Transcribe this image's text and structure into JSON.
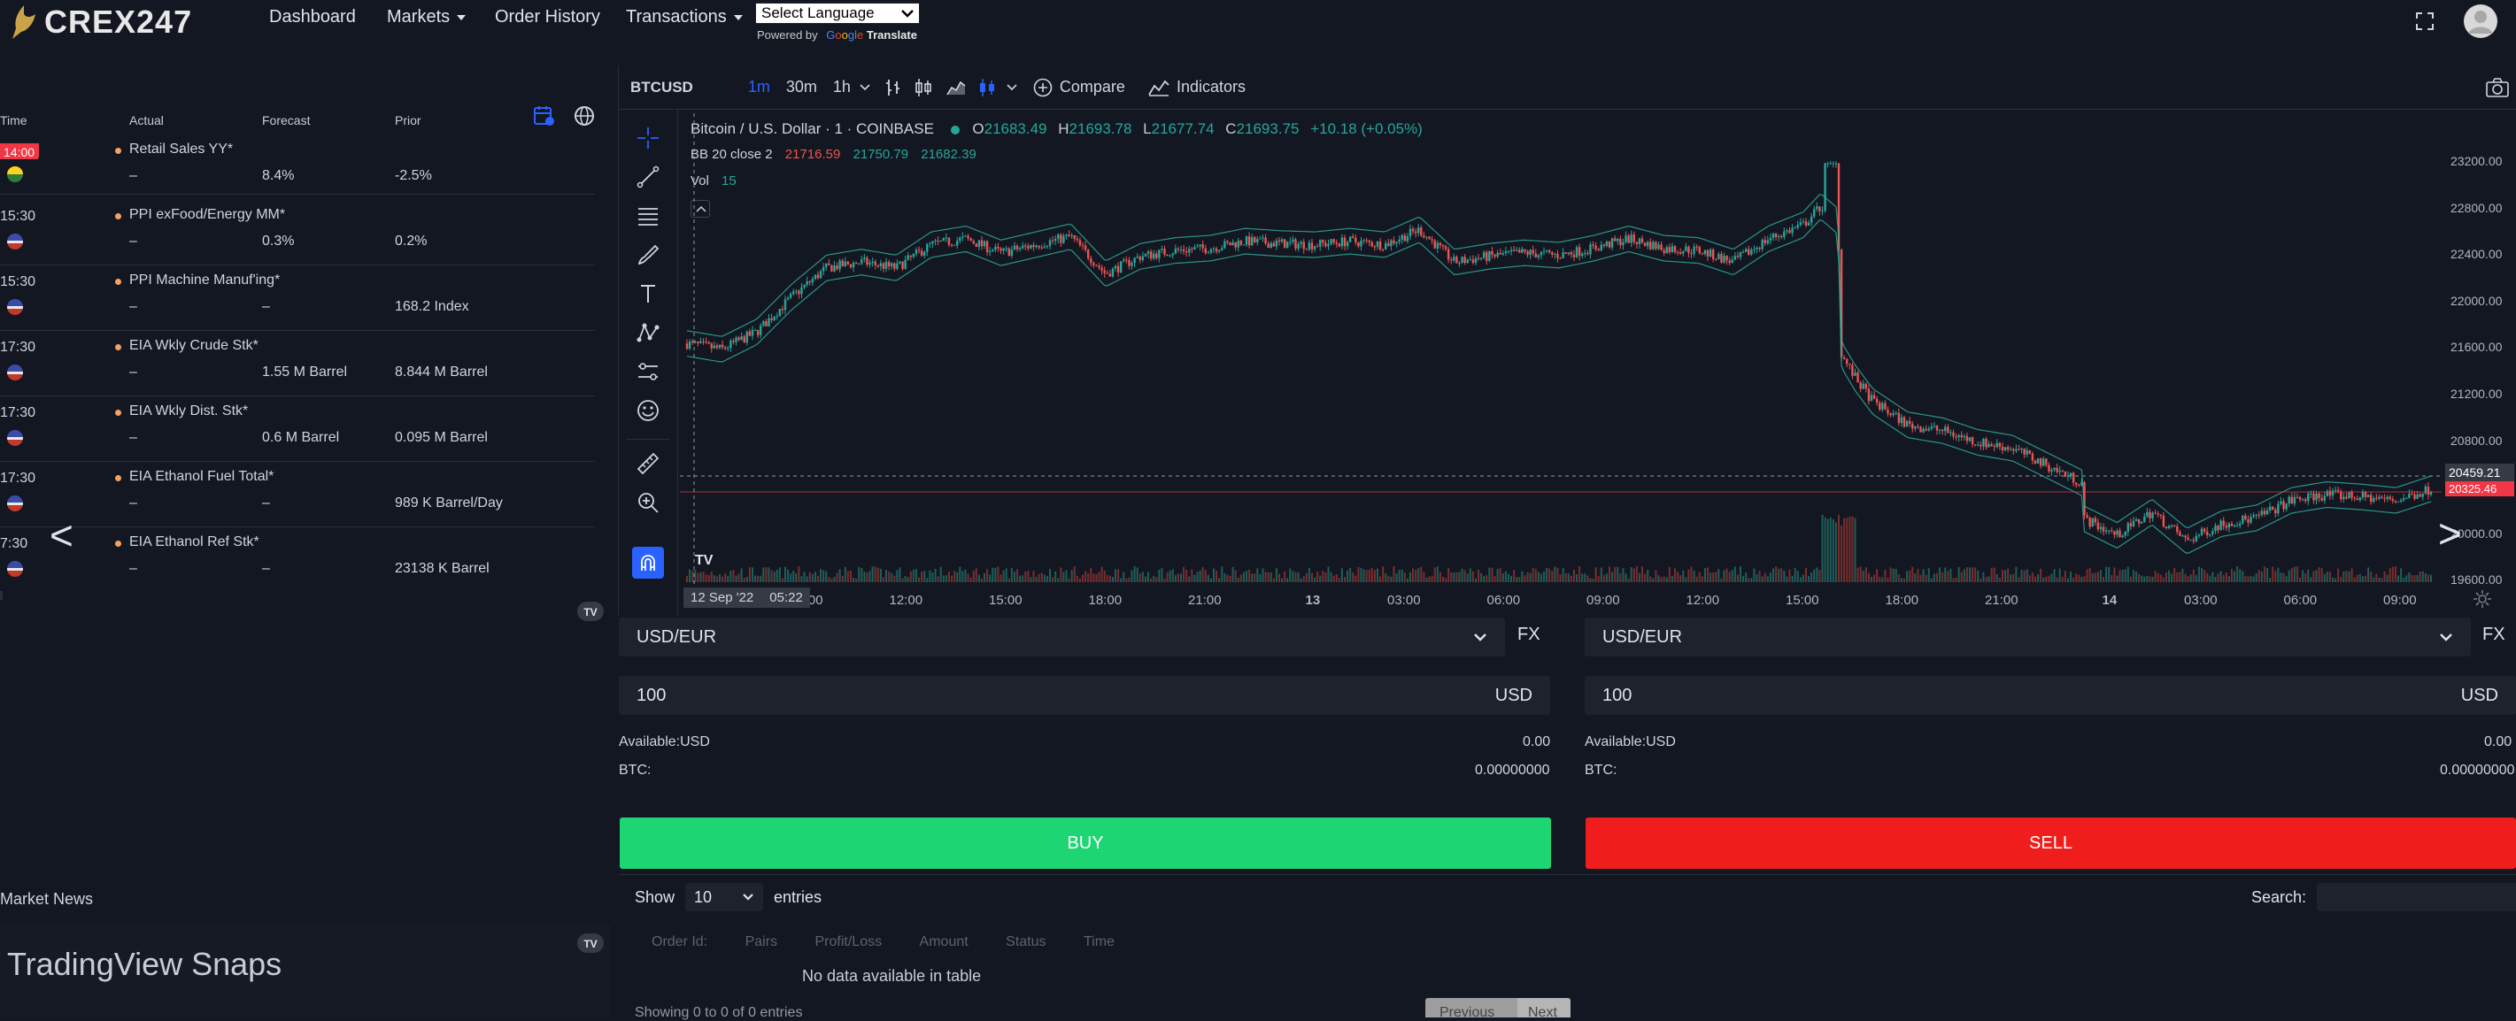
{
  "brand": "CREX247",
  "nav": {
    "dashboard": "Dashboard",
    "markets": "Markets",
    "order_history": "Order History",
    "transactions": "Transactions",
    "language_select": "Select Language",
    "powered_by": "Powered by",
    "translate": "Translate"
  },
  "calendar": {
    "headers": {
      "time": "Time",
      "actual": "Actual",
      "forecast": "Forecast",
      "prior": "Prior"
    },
    "events": [
      {
        "time": "14:00",
        "name": "Retail Sales YY*",
        "actual": "–",
        "forecast": "8.4%",
        "prior": "-2.5%"
      },
      {
        "time": "15:30",
        "name": "PPI exFood/Energy MM*",
        "actual": "–",
        "forecast": "0.3%",
        "prior": "0.2%"
      },
      {
        "time": "15:30",
        "name": "PPI Machine Manuf'ing*",
        "actual": "–",
        "forecast": "–",
        "prior": "168.2 Index"
      },
      {
        "time": "17:30",
        "name": "EIA Wkly Crude Stk*",
        "actual": "–",
        "forecast": "1.55 M Barrel",
        "prior": "8.844 M Barrel"
      },
      {
        "time": "17:30",
        "name": "EIA Wkly Dist. Stk*",
        "actual": "–",
        "forecast": "0.6 M Barrel",
        "prior": "0.095 M Barrel"
      },
      {
        "time": "17:30",
        "name": "EIA Ethanol Fuel Total*",
        "actual": "–",
        "forecast": "–",
        "prior": "989 K Barrel/Day"
      },
      {
        "time": "7:30",
        "name": "EIA Ethanol Ref Stk*",
        "actual": "–",
        "forecast": "–",
        "prior": "23138 K Barrel"
      }
    ],
    "prev_arrow": "<"
  },
  "chart": {
    "symbol": "BTCUSD",
    "intervals": [
      "1m",
      "30m",
      "1h"
    ],
    "compare": "Compare",
    "indicators": "Indicators",
    "title": "Bitcoin / U.S. Dollar · 1 · COINBASE",
    "ohlc": {
      "o_label": "O",
      "o": "21683.49",
      "h_label": "H",
      "h": "21693.78",
      "l_label": "L",
      "l": "21677.74",
      "c_label": "C",
      "c": "21693.75",
      "change": "+10.18 (+0.05%)"
    },
    "bb_label": "BB 20 close 2",
    "bb_values": [
      "21716.59",
      "21750.79",
      "21682.39"
    ],
    "vol_label": "Vol",
    "vol_value": "15",
    "price_ticks": [
      "23200.00",
      "22800.00",
      "22400.00",
      "22000.00",
      "21600.00",
      "21200.00",
      "20800.00",
      "20400.00",
      "20000.00",
      "19600.00"
    ],
    "current_price": "20459.21",
    "second_price": "20325.46",
    "time_ticks": [
      "09:00",
      "12:00",
      "15:00",
      "18:00",
      "21:00",
      "13",
      "03:00",
      "06:00",
      "09:00",
      "12:00",
      "15:00",
      "18:00",
      "21:00",
      "14",
      "03:00",
      "06:00",
      "09:00"
    ],
    "crosshair_date": "12 Sep '22",
    "crosshair_time": "05:22",
    "next_arrow": ">",
    "colors": {
      "up": "#26a69a",
      "down": "#ef5350",
      "bb": "#2fb5a0"
    }
  },
  "buy_panel": {
    "pair": "USD/EUR",
    "fx": "FX",
    "amount": "100",
    "currency": "USD",
    "available_label": "Available:USD",
    "available_value": "0.00",
    "btc_label": "BTC:",
    "btc_value": "0.00000000",
    "button": "BUY",
    "color": "#1ed574"
  },
  "sell_panel": {
    "pair": "USD/EUR",
    "fx": "FX",
    "amount": "100",
    "currency": "USD",
    "available_label": "Available:USD",
    "available_value": "0.00",
    "btc_label": "BTC:",
    "btc_value": "0.00000000",
    "button": "SELL",
    "color": "#f01d1d"
  },
  "orders": {
    "show_label": "Show",
    "entries_value": "10",
    "entries_label": "entries",
    "search_label": "Search:",
    "columns": [
      "Order Id:",
      "Pairs",
      "Profit/Loss",
      "Amount",
      "Status",
      "Time"
    ],
    "empty": "No data available in table",
    "footer": "Showing 0 to 0 of 0 entries",
    "prev": "Previous",
    "next": "Next"
  },
  "news": {
    "title": "Market News",
    "snaps": "TradingView Snaps"
  }
}
